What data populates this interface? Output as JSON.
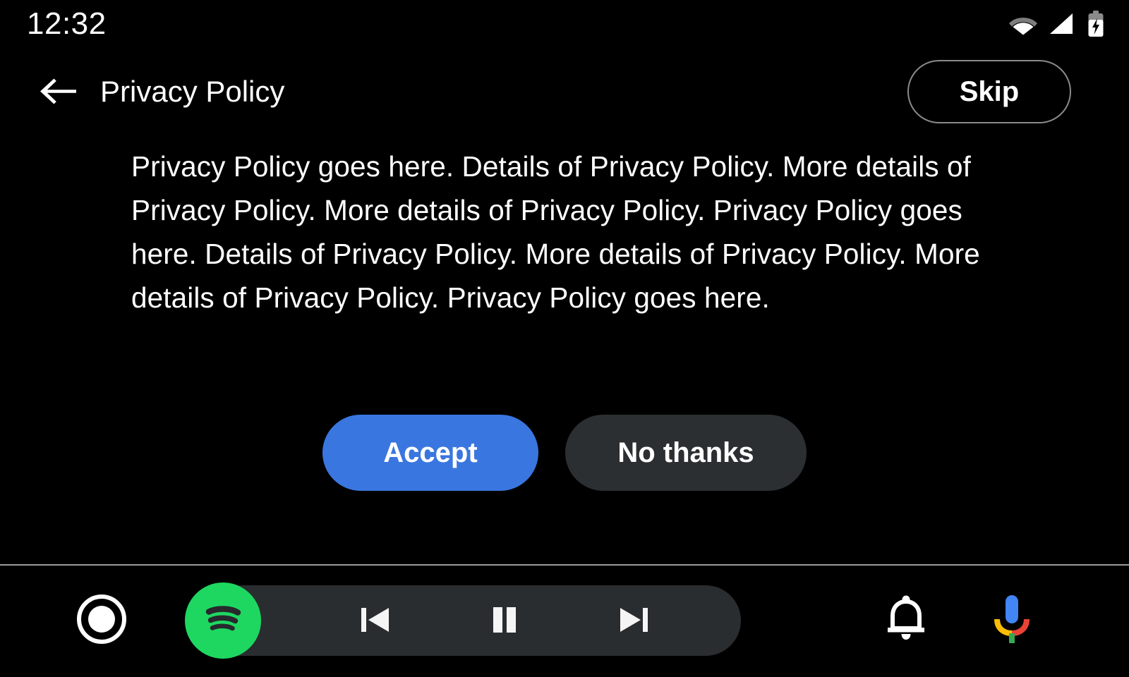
{
  "status_bar": {
    "clock": "12:32",
    "icons": [
      {
        "name": "wifi-icon",
        "label": "Wi-Fi"
      },
      {
        "name": "cellular-signal-icon",
        "label": "Cellular signal"
      },
      {
        "name": "battery-charging-icon",
        "label": "Battery charging"
      }
    ]
  },
  "header": {
    "back_icon": "arrow-left-icon",
    "title": "Privacy Policy",
    "skip_label": "Skip",
    "skip_border_color": "#8a8a8a"
  },
  "main": {
    "policy_text": "Privacy Policy goes here. Details of Privacy Policy. More details of Privacy Policy. More details of Privacy Policy. Privacy Policy goes here. Details of Privacy Policy. More details of Privacy Policy. More details of Privacy Policy. Privacy Policy goes here.",
    "accept_label": "Accept",
    "decline_label": "No thanks",
    "accept_color": "#3a76df",
    "decline_color": "#2c2f31"
  },
  "nav_bar": {
    "home_icon": "home-circle-icon",
    "app_icon": "spotify-icon",
    "app_color": "#1ed760",
    "media_pill_color": "#2a2d2f",
    "controls": [
      {
        "name": "previous-track-button",
        "label": "Previous"
      },
      {
        "name": "pause-button",
        "label": "Pause"
      },
      {
        "name": "next-track-button",
        "label": "Next"
      }
    ],
    "notifications_icon": "bell-icon",
    "assistant_icon": "google-assistant-mic-icon",
    "assistant_colors": {
      "body": "#4285f4",
      "left_arc": "#fbbc04",
      "right_arc": "#ea4335",
      "stem": "#34a853"
    }
  }
}
